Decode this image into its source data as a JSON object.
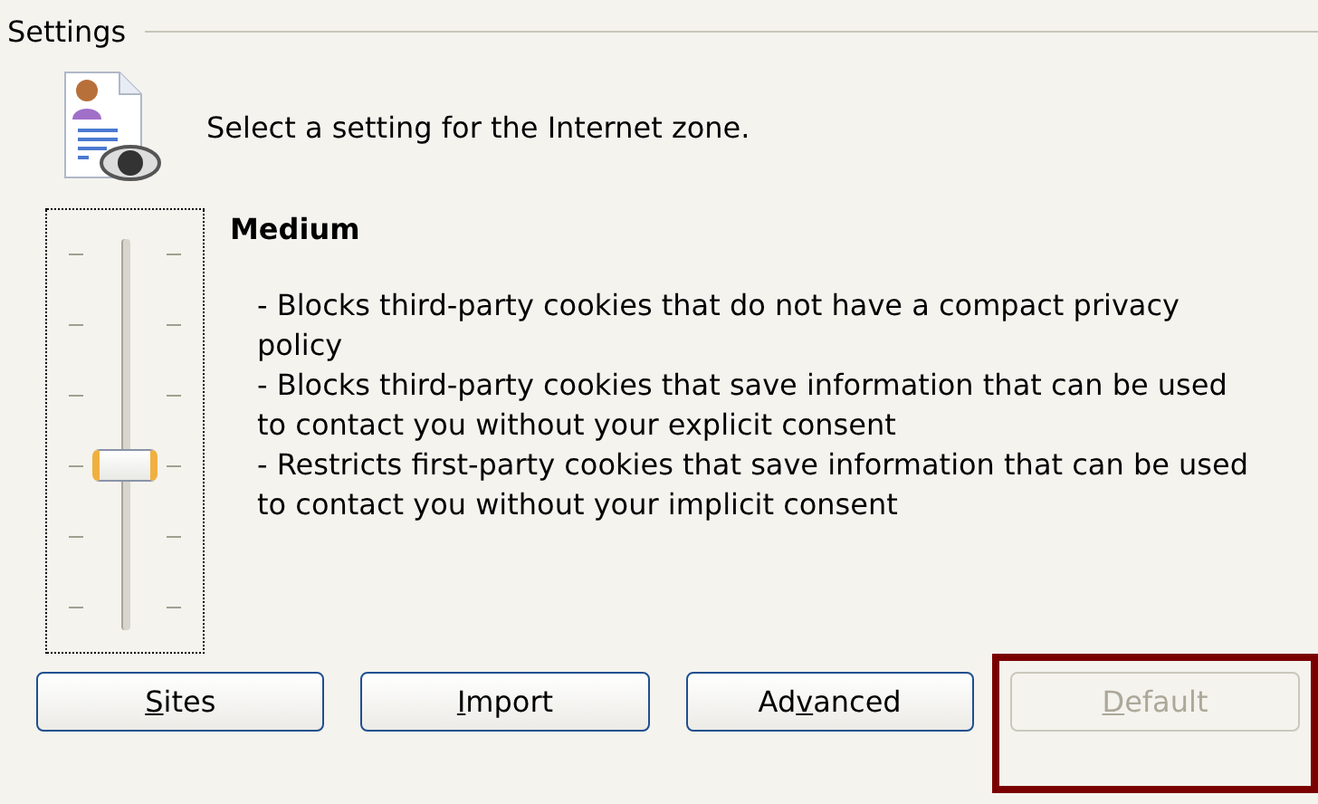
{
  "group": {
    "title": "Settings"
  },
  "description": "Select a setting for the Internet zone.",
  "slider": {
    "level": 0.4
  },
  "level_name": "Medium",
  "details": [
    "- Blocks third-party cookies that do not have a compact privacy policy",
    "- Blocks third-party cookies that save information that can be used to contact you without your explicit consent",
    "- Restricts first-party cookies that save information that can be used to contact you without your implicit consent"
  ],
  "buttons": [
    {
      "access_key": "S",
      "after_key": "ites",
      "disabled": false,
      "highlighted": false
    },
    {
      "access_key": "I",
      "after_key": "mport",
      "disabled": false,
      "highlighted": false
    },
    {
      "before_key": "Ad",
      "access_key": "v",
      "after_key": "anced",
      "disabled": false,
      "highlighted": false
    },
    {
      "access_key": "D",
      "after_key": "efault",
      "disabled": true,
      "highlighted": true
    }
  ]
}
